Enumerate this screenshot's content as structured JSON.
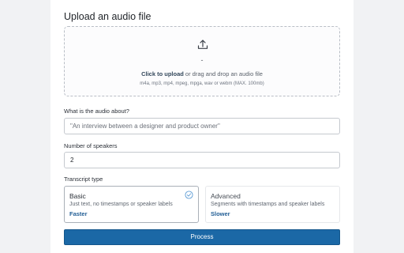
{
  "upload": {
    "title": "Upload an audio file",
    "dash": "-",
    "click_label": "Click to upload",
    "drag_label": " or drag and drop an audio file",
    "formats": "m4a, mp3, mp4, mpeg, mpga, wav or webm (MAX. 100mb)",
    "icon": "upload-icon"
  },
  "about": {
    "label": "What is the audio about?",
    "placeholder": "\"An interview between a designer and product owner\"",
    "value": ""
  },
  "speakers": {
    "label": "Number of speakers",
    "value": "2"
  },
  "transcript": {
    "label": "Transcript type",
    "options": [
      {
        "title": "Basic",
        "description": "Just text, no timestamps or speaker labels",
        "speed": "Faster",
        "selected": true
      },
      {
        "title": "Advanced",
        "description": "Segments with timestamps and speaker labels",
        "speed": "Slower",
        "selected": false
      }
    ]
  },
  "process_button": "Process",
  "colors": {
    "accent": "#1b68a6",
    "speed_text": "#225e95",
    "check": "#5b9bd5",
    "background": "#f1f2f4"
  }
}
